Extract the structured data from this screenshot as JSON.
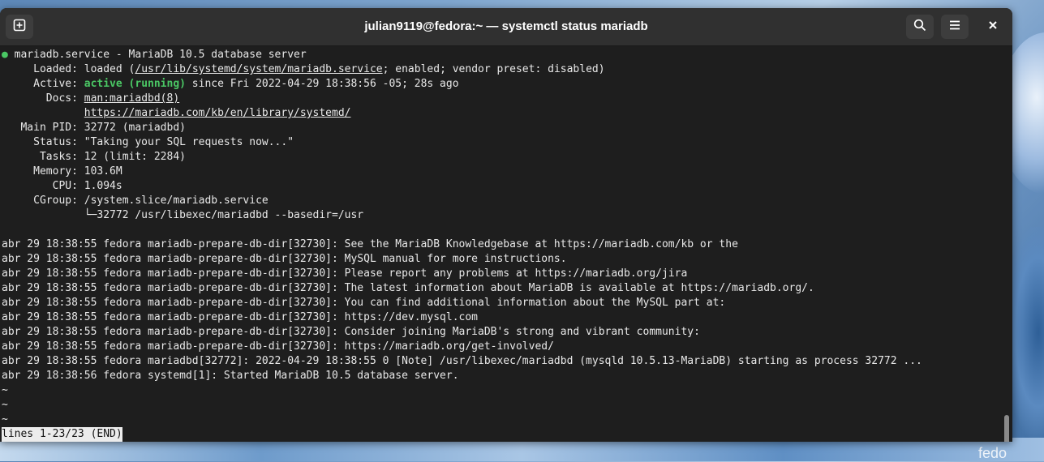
{
  "window": {
    "title": "julian9119@fedora:~ — systemctl status mariadb",
    "new_tab_icon": "new-tab-icon",
    "search_icon": "search-icon",
    "menu_icon": "hamburger-menu-icon",
    "close_icon": "close-icon"
  },
  "wallpaper": {
    "logo_text": "fedo"
  },
  "service": {
    "dot": "●",
    "header": " mariadb.service - MariaDB 10.5 database server",
    "loaded_label": "     Loaded: ",
    "loaded_pre": "loaded (",
    "loaded_path": "/usr/lib/systemd/system/mariadb.service",
    "loaded_post": "; enabled; vendor preset: disabled)",
    "active_label": "     Active: ",
    "active_state": "active (running)",
    "active_since": " since Fri 2022-04-29 18:38:56 -05; 28s ago",
    "docs_label": "       Docs: ",
    "docs_1": "man:mariadbd(8)",
    "docs_indent": "             ",
    "docs_2": "https://mariadb.com/kb/en/library/systemd/",
    "mainpid": "   Main PID: 32772 (mariadbd)",
    "status": "     Status: \"Taking your SQL requests now...\"",
    "tasks": "      Tasks: 12 (limit: 2284)",
    "memory": "     Memory: 103.6M",
    "cpu": "        CPU: 1.094s",
    "cgroup": "     CGroup: /system.slice/mariadb.service",
    "cgroup_child": "             └─32772 /usr/libexec/mariadbd --basedir=/usr"
  },
  "log_lines": [
    "abr 29 18:38:55 fedora mariadb-prepare-db-dir[32730]: See the MariaDB Knowledgebase at https://mariadb.com/kb or the",
    "abr 29 18:38:55 fedora mariadb-prepare-db-dir[32730]: MySQL manual for more instructions.",
    "abr 29 18:38:55 fedora mariadb-prepare-db-dir[32730]: Please report any problems at https://mariadb.org/jira",
    "abr 29 18:38:55 fedora mariadb-prepare-db-dir[32730]: The latest information about MariaDB is available at https://mariadb.org/.",
    "abr 29 18:38:55 fedora mariadb-prepare-db-dir[32730]: You can find additional information about the MySQL part at:",
    "abr 29 18:38:55 fedora mariadb-prepare-db-dir[32730]: https://dev.mysql.com",
    "abr 29 18:38:55 fedora mariadb-prepare-db-dir[32730]: Consider joining MariaDB's strong and vibrant community:",
    "abr 29 18:38:55 fedora mariadb-prepare-db-dir[32730]: https://mariadb.org/get-involved/",
    "abr 29 18:38:55 fedora mariadbd[32772]: 2022-04-29 18:38:55 0 [Note] /usr/libexec/mariadbd (mysqld 10.5.13-MariaDB) starting as process 32772 ...",
    "abr 29 18:38:56 fedora systemd[1]: Started MariaDB 10.5 database server."
  ],
  "tildes": [
    "~",
    "~",
    "~"
  ],
  "pager_status": "lines 1-23/23 (END)"
}
